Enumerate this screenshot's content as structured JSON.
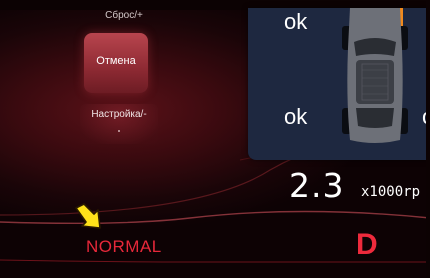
{
  "left_panel": {
    "reset_label": "Сброс/+",
    "cancel_label": "Отмена",
    "settings_label": "Настройка/-"
  },
  "tire_pressure": {
    "front_left": "ok",
    "rear_left": "ok",
    "rear_right_partial": "o"
  },
  "tachometer": {
    "value": "2.3",
    "unit": "x1000rp"
  },
  "drive_mode": "NORMAL",
  "gear": "D",
  "colors": {
    "accent_red": "#e8283a",
    "panel_blue": "#1e2840",
    "warning_orange": "#f08a1e",
    "arrow_yellow": "#ffe21a"
  }
}
